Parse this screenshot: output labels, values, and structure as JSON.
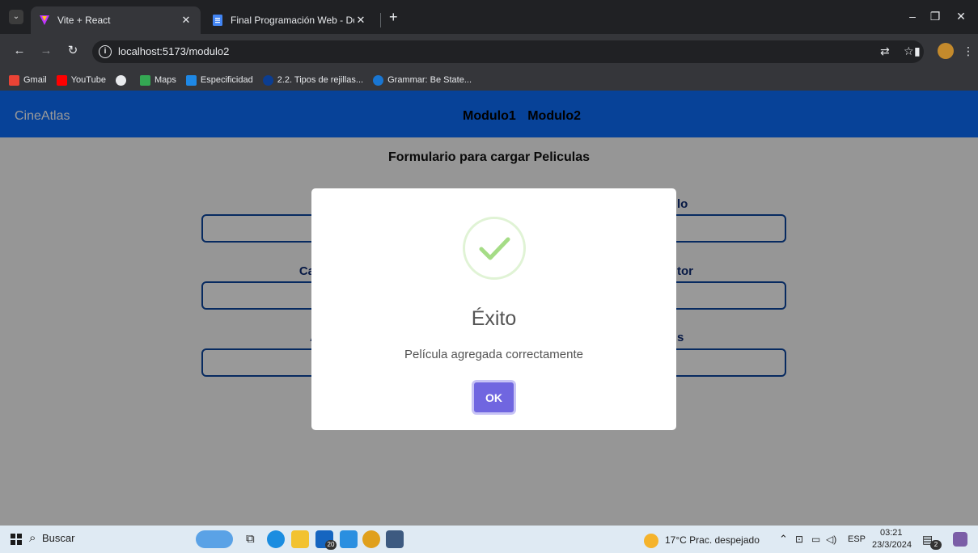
{
  "browser": {
    "tabs": [
      {
        "title": "Vite + React",
        "active": true
      },
      {
        "title": "Final Programación Web - Docu",
        "active": false
      }
    ],
    "url": "localhost:5173/modulo2",
    "bookmarks": [
      "Gmail",
      "YouTube",
      "Maps",
      "Especificidad",
      "2.2. Tipos de rejillas...",
      "Grammar: Be State..."
    ]
  },
  "app": {
    "brand": "CineAtlas",
    "nav": [
      "Modulo1",
      "Modulo2"
    ],
    "form_title": "Formulario para cargar Peliculas",
    "visible_label_fragments": [
      "Cat",
      "lo",
      "tor",
      "A",
      "s"
    ]
  },
  "dialog": {
    "title": "Éxito",
    "message": "Película agregada correctamente",
    "ok_label": "OK",
    "icon": "success-check-icon"
  },
  "taskbar": {
    "search_placeholder": "Buscar",
    "mail_badge": "20",
    "weather": "17°C  Prac. despejado",
    "language": "ESP",
    "time": "03:21",
    "date": "23/3/2024",
    "notifications": "2"
  },
  "colors": {
    "navbar": "#0d6efd",
    "ok_button": "#7066e0",
    "success": "#a5dc86"
  }
}
